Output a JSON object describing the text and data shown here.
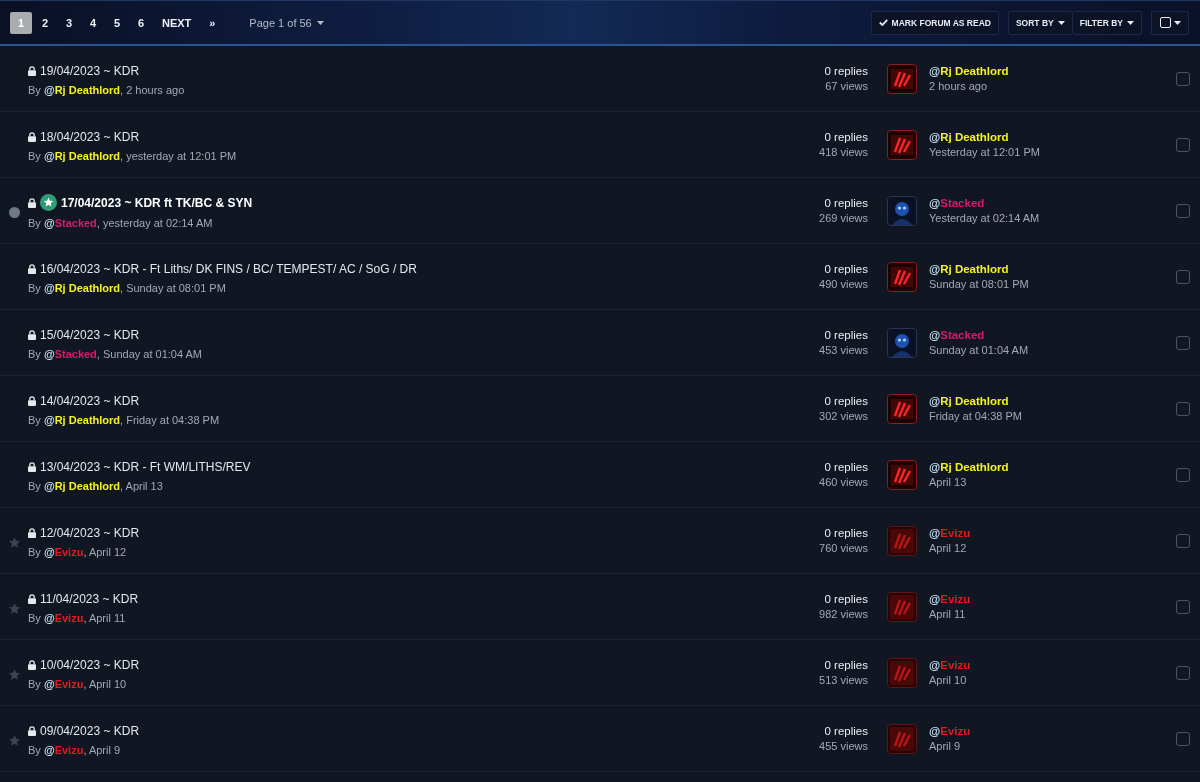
{
  "pagination": {
    "pages": [
      {
        "label": "1",
        "selected": true
      },
      {
        "label": "2",
        "selected": false
      },
      {
        "label": "3",
        "selected": false
      },
      {
        "label": "4",
        "selected": false
      },
      {
        "label": "5",
        "selected": false
      },
      {
        "label": "6",
        "selected": false
      }
    ],
    "next": "NEXT",
    "last": "»",
    "jump": "Page 1 of 56"
  },
  "toolbar": {
    "mark_read": "MARK FORUM AS READ",
    "sort": "SORT BY",
    "filter": "FILTER BY",
    "select_all": {
      "checked": false
    }
  },
  "rows": [
    {
      "title": "19/04/2023 ~ KDR",
      "unread": false,
      "posted": false,
      "locked": true,
      "featured": false,
      "by": "By",
      "author": {
        "at": "@",
        "name": "Rj Deathlord",
        "color": "#f4f41e"
      },
      "started": ", 2 hours ago",
      "replies": "0 replies",
      "views": "67 views",
      "last_poster": {
        "at": "@",
        "name": "Rj Deathlord",
        "color": "#f4f41e",
        "avatar": {
          "kind": "red-logo"
        }
      },
      "last_post": "2 hours ago",
      "selected": false
    },
    {
      "title": "18/04/2023 ~ KDR",
      "unread": false,
      "posted": false,
      "locked": true,
      "featured": false,
      "by": "By",
      "author": {
        "at": "@",
        "name": "Rj Deathlord",
        "color": "#f4f41e"
      },
      "started": ", yesterday at 12:01 PM",
      "replies": "0 replies",
      "views": "418 views",
      "last_poster": {
        "at": "@",
        "name": "Rj Deathlord",
        "color": "#f4f41e",
        "avatar": {
          "kind": "red-logo"
        }
      },
      "last_post": "Yesterday at 12:01 PM",
      "selected": false
    },
    {
      "title": "17/04/2023 ~ KDR ft TK/BC & SYN",
      "unread": true,
      "posted": false,
      "locked": true,
      "featured": true,
      "by": "By",
      "author": {
        "at": "@",
        "name": "Stacked",
        "color": "#d81b6a"
      },
      "started": ", yesterday at 02:14 AM",
      "replies": "0 replies",
      "views": "269 views",
      "last_poster": {
        "at": "@",
        "name": "Stacked",
        "color": "#d81b6a",
        "avatar": {
          "kind": "blue-figure"
        }
      },
      "last_post": "Yesterday at 02:14 AM",
      "selected": false
    },
    {
      "title": "16/04/2023 ~ KDR - Ft Liths/ DK FINS / BC/ TEMPEST/ AC / SoG / DR",
      "unread": false,
      "posted": false,
      "locked": true,
      "featured": false,
      "by": "By",
      "author": {
        "at": "@",
        "name": "Rj Deathlord",
        "color": "#f4f41e"
      },
      "started": ", Sunday at 08:01 PM",
      "replies": "0 replies",
      "views": "490 views",
      "last_poster": {
        "at": "@",
        "name": "Rj Deathlord",
        "color": "#f4f41e",
        "avatar": {
          "kind": "red-logo"
        }
      },
      "last_post": "Sunday at 08:01 PM",
      "selected": false
    },
    {
      "title": "15/04/2023 ~ KDR",
      "unread": false,
      "posted": false,
      "locked": true,
      "featured": false,
      "by": "By",
      "author": {
        "at": "@",
        "name": "Stacked",
        "color": "#d81b6a"
      },
      "started": ", Sunday at 01:04 AM",
      "replies": "0 replies",
      "views": "453 views",
      "last_poster": {
        "at": "@",
        "name": "Stacked",
        "color": "#d81b6a",
        "avatar": {
          "kind": "blue-figure"
        }
      },
      "last_post": "Sunday at 01:04 AM",
      "selected": false
    },
    {
      "title": "14/04/2023 ~ KDR",
      "unread": false,
      "posted": false,
      "locked": true,
      "featured": false,
      "by": "By",
      "author": {
        "at": "@",
        "name": "Rj Deathlord",
        "color": "#f4f41e"
      },
      "started": ", Friday at 04:38 PM",
      "replies": "0 replies",
      "views": "302 views",
      "last_poster": {
        "at": "@",
        "name": "Rj Deathlord",
        "color": "#f4f41e",
        "avatar": {
          "kind": "red-logo"
        }
      },
      "last_post": "Friday at 04:38 PM",
      "selected": false
    },
    {
      "title": "13/04/2023 ~ KDR - Ft WM/LITHS/REV",
      "unread": false,
      "posted": false,
      "locked": true,
      "featured": false,
      "by": "By",
      "author": {
        "at": "@",
        "name": "Rj Deathlord",
        "color": "#f4f41e"
      },
      "started": ", April 13",
      "replies": "0 replies",
      "views": "460 views",
      "last_poster": {
        "at": "@",
        "name": "Rj Deathlord",
        "color": "#f4f41e",
        "avatar": {
          "kind": "red-logo"
        }
      },
      "last_post": "April 13",
      "selected": false
    },
    {
      "title": "12/04/2023 ~ KDR",
      "unread": false,
      "posted": true,
      "locked": true,
      "featured": false,
      "by": "By",
      "author": {
        "at": "@",
        "name": "Evizu",
        "color": "#e01c1c"
      },
      "started": ", April 12",
      "replies": "0 replies",
      "views": "760 views",
      "last_poster": {
        "at": "@",
        "name": "Evizu",
        "color": "#e01c1c",
        "avatar": {
          "kind": "dark-red-logo"
        }
      },
      "last_post": "April 12",
      "selected": false
    },
    {
      "title": "11/04/2023 ~ KDR",
      "unread": false,
      "posted": true,
      "locked": true,
      "featured": false,
      "by": "By",
      "author": {
        "at": "@",
        "name": "Evizu",
        "color": "#e01c1c"
      },
      "started": ", April 11",
      "replies": "0 replies",
      "views": "982 views",
      "last_poster": {
        "at": "@",
        "name": "Evizu",
        "color": "#e01c1c",
        "avatar": {
          "kind": "dark-red-logo"
        }
      },
      "last_post": "April 11",
      "selected": false
    },
    {
      "title": "10/04/2023 ~ KDR",
      "unread": false,
      "posted": true,
      "locked": true,
      "featured": false,
      "by": "By",
      "author": {
        "at": "@",
        "name": "Evizu",
        "color": "#e01c1c"
      },
      "started": ", April 10",
      "replies": "0 replies",
      "views": "513 views",
      "last_poster": {
        "at": "@",
        "name": "Evizu",
        "color": "#e01c1c",
        "avatar": {
          "kind": "dark-red-logo"
        }
      },
      "last_post": "April 10",
      "selected": false
    },
    {
      "title": "09/04/2023 ~ KDR",
      "unread": false,
      "posted": true,
      "locked": true,
      "featured": false,
      "by": "By",
      "author": {
        "at": "@",
        "name": "Evizu",
        "color": "#e01c1c"
      },
      "started": ", April 9",
      "replies": "0 replies",
      "views": "455 views",
      "last_poster": {
        "at": "@",
        "name": "Evizu",
        "color": "#e01c1c",
        "avatar": {
          "kind": "dark-red-logo"
        }
      },
      "last_post": "April 9",
      "selected": false
    }
  ]
}
